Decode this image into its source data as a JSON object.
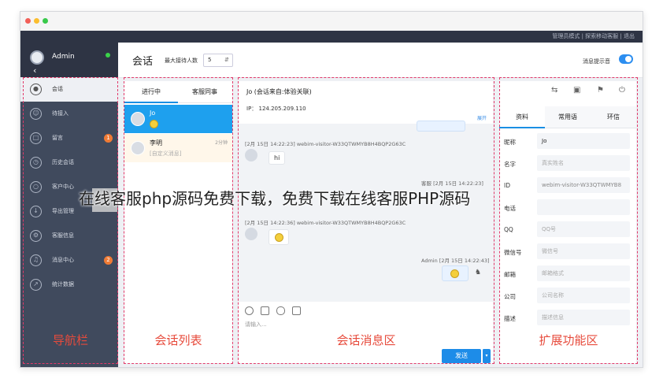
{
  "window": {
    "traffic_colors": [
      "#f25f58",
      "#fbbe2e",
      "#38c94a"
    ]
  },
  "topbar": {
    "links": "管理员模式 | 探索移动客服 | 退出"
  },
  "sidebar": {
    "user": "Admin",
    "back_icon": "chevron-left-icon",
    "items": [
      {
        "label": "会话",
        "icon": "chat-icon",
        "active": true
      },
      {
        "label": "待接入",
        "icon": "person-icon"
      },
      {
        "label": "留言",
        "icon": "message-icon",
        "badge": "1"
      },
      {
        "label": "历史会话",
        "icon": "history-icon"
      },
      {
        "label": "客户中心",
        "icon": "customer-icon"
      },
      {
        "label": "导出管理",
        "icon": "download-icon"
      },
      {
        "label": "客服信息",
        "icon": "settings-icon"
      },
      {
        "label": "消息中心",
        "icon": "bell-icon",
        "badge": "2"
      },
      {
        "label": "统计数据",
        "icon": "stats-icon"
      }
    ]
  },
  "header": {
    "title": "会话",
    "max_label": "最大接待人数",
    "max_value": "5",
    "sound_label": "消息提示音",
    "sound_on": true
  },
  "conv_list": {
    "tabs": [
      "进行中",
      "客服同事"
    ],
    "items": [
      {
        "name": "Jo",
        "sub": "",
        "time": ""
      },
      {
        "name": "李明",
        "sub": "[自定义消息]",
        "time": "2分钟"
      }
    ]
  },
  "chat": {
    "title": "Jo (会话来自:体验关联)",
    "ip": "IP： 124.205.209.110",
    "more": "展开",
    "messages": [
      {
        "meta": "[2月 15日 14:22:23] webim-visitor-W33QTWMYB8H4BQP2G63C",
        "text": "hi",
        "from": "visitor"
      },
      {
        "meta": "客服 [2月 15日 14:22:23]",
        "text": "",
        "from": "agent"
      },
      {
        "meta": "[2月 15日 14:22:36] webim-visitor-W33QTWMYB8H4BQP2G63C",
        "text": "",
        "from": "visitor"
      },
      {
        "meta": "Admin [2月 15日 14:22:43]",
        "text": "",
        "from": "agent"
      }
    ],
    "placeholder": "请输入...",
    "send": "发送"
  },
  "ext": {
    "tabs": [
      "资料",
      "常用语",
      "环信"
    ],
    "fields": [
      {
        "label": "昵称",
        "value": "Jo",
        "placeholder": false
      },
      {
        "label": "名字",
        "value": "真实姓名",
        "placeholder": true
      },
      {
        "label": "ID",
        "value": "webim-visitor-W33QTWMYB8",
        "placeholder": false
      },
      {
        "label": "电话",
        "value": "",
        "placeholder": true
      },
      {
        "label": "QQ",
        "value": "QQ号",
        "placeholder": true
      },
      {
        "label": "微信号",
        "value": "微信号",
        "placeholder": true
      },
      {
        "label": "邮箱",
        "value": "邮箱格式",
        "placeholder": true
      },
      {
        "label": "公司",
        "value": "公司名称",
        "placeholder": true
      },
      {
        "label": "描述",
        "value": "描述信息",
        "placeholder": true
      }
    ]
  },
  "zones": {
    "nav": "导航栏",
    "list": "会话列表",
    "msg": "会话消息区",
    "ext": "扩展功能区"
  },
  "watermark": "在线客服php源码免费下载，免费下载在线客服PHP源码",
  "colors": {
    "accent": "#1a8fe3",
    "nav_bg": "#404a5d",
    "zone_border": "#e23a6a",
    "zone_text": "#e74b3c"
  }
}
